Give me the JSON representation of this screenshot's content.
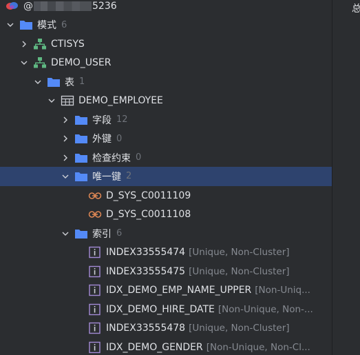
{
  "connection": {
    "prefix": "@",
    "suffix": "5236"
  },
  "right_panel": {
    "title": "总"
  },
  "tree": {
    "schemas": {
      "label": "模式",
      "count": "6"
    },
    "ctisys": {
      "label": "CTISYS"
    },
    "demo_user": {
      "label": "DEMO_USER"
    },
    "tables": {
      "label": "表",
      "count": "1"
    },
    "demo_employee": {
      "label": "DEMO_EMPLOYEE"
    },
    "fields": {
      "label": "字段",
      "count": "12"
    },
    "foreign_keys": {
      "label": "外键",
      "count": "0"
    },
    "check_constraints": {
      "label": "检查约束",
      "count": "0"
    },
    "unique_keys": {
      "label": "唯一键",
      "count": "2"
    },
    "uk_items": [
      {
        "label": "D_SYS_C0011109"
      },
      {
        "label": "D_SYS_C0011108"
      }
    ],
    "indexes": {
      "label": "索引",
      "count": "6"
    },
    "index_items": [
      {
        "label": "INDEX33555474",
        "detail": "[Unique, Non-Cluster]"
      },
      {
        "label": "INDEX33555475",
        "detail": "[Unique, Non-Cluster]"
      },
      {
        "label": "IDX_DEMO_EMP_NAME_UPPER",
        "detail": "[Non-Uniq..."
      },
      {
        "label": "IDX_DEMO_HIRE_DATE",
        "detail": "[Non-Unique, Non-..."
      },
      {
        "label": "INDEX33555478",
        "detail": "[Unique, Non-Cluster]"
      },
      {
        "label": "IDX_DEMO_GENDER",
        "detail": "[Non-Unique, Non-Cl..."
      }
    ]
  },
  "colors": {
    "background": "#2b2d30",
    "selection": "#2e436e",
    "folder": "#548af7",
    "schema_icon": "#5fb882",
    "unique_key_icon": "#e08855",
    "index_icon": "#a48ad6",
    "text": "#dfe1e5",
    "muted": "#6f737a"
  },
  "icons": {
    "expanded": "chevron-down-icon",
    "collapsed": "chevron-right-icon",
    "folder": "folder-icon",
    "schema": "schema-icon",
    "table": "table-icon",
    "unique_key": "unique-key-icon",
    "index": "index-icon",
    "datasource": "datasource-icon"
  }
}
